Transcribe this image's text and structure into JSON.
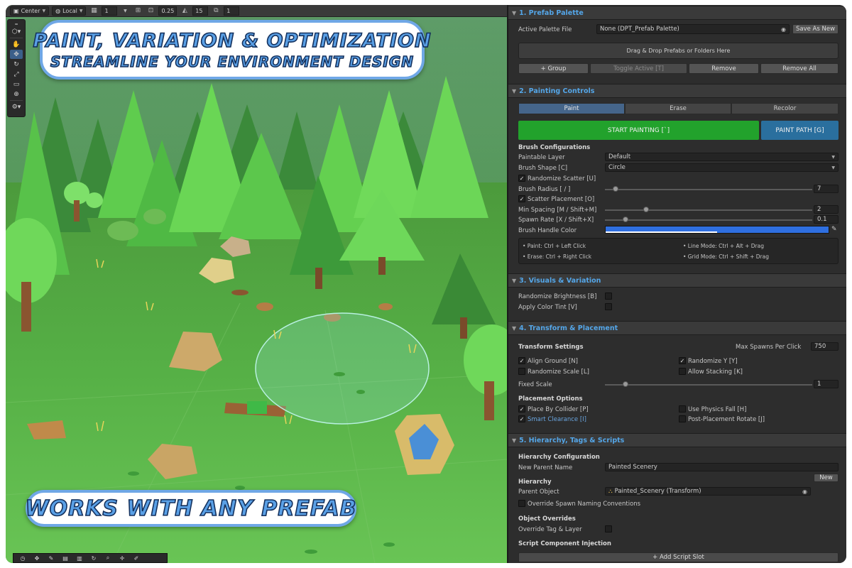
{
  "scene_toolbar": {
    "pivot_label": "Center",
    "space_label": "Local",
    "grid_value": "1",
    "snap_increment": "0.25",
    "rotate_snap": "15",
    "scale_snap": "1"
  },
  "banners": {
    "top_line1": "PAINT, VARIATION & OPTIMIZATION",
    "top_line2": "STREAMLINE YOUR ENVIRONMENT DESIGN",
    "bottom": "WORKS WITH ANY PREFAB"
  },
  "colors": {
    "section_title": "#54a6e8",
    "start_painting": "#22a22c",
    "paint_path": "#2a6f9e",
    "brush_handle": "#2f6fe0",
    "active_tab": "#45658a",
    "smart_clearance_text": "#6aa6e0"
  },
  "prefab_palette": {
    "title": "1. Prefab Palette",
    "active_palette_label": "Active Palette File",
    "active_palette_value": "None (DPT_Prefab Palette)",
    "save_as_new": "Save As New",
    "dropzone": "Drag & Drop Prefabs or Folders Here",
    "buttons": [
      "+ Group",
      "Toggle Active [T]",
      "Remove",
      "Remove All"
    ]
  },
  "painting_controls": {
    "title": "2. Painting Controls",
    "tabs": [
      "Paint",
      "Erase",
      "Recolor"
    ],
    "start_painting": "START PAINTING [`]",
    "paint_path": "PAINT PATH [G]",
    "brush_configurations": "Brush Configurations",
    "paintable_layer_label": "Paintable Layer",
    "paintable_layer_value": "Default",
    "brush_shape_label": "Brush Shape [C]",
    "brush_shape_value": "Circle",
    "randomize_scatter": "Randomize Scatter [U]",
    "brush_radius_label": "Brush Radius [ / ]",
    "brush_radius_value": "7",
    "brush_radius_fraction": 0.05,
    "scatter_placement": "Scatter Placement [O]",
    "min_spacing_label": "Min Spacing [M / Shift+M]",
    "min_spacing_value": "2",
    "min_spacing_fraction": 0.2,
    "spawn_rate_label": "Spawn Rate [X / Shift+X]",
    "spawn_rate_value": "0.1",
    "spawn_rate_fraction": 0.1,
    "brush_handle_color_label": "Brush Handle Color",
    "hints": [
      "• Paint: Ctrl + Left Click",
      "• Line Mode: Ctrl + Alt + Drag",
      "• Erase: Ctrl + Right Click",
      "• Grid Mode: Ctrl + Shift + Drag"
    ]
  },
  "visuals": {
    "title": "3. Visuals & Variation",
    "randomize_brightness": "Randomize Brightness [B]",
    "apply_color_tint": "Apply Color Tint [V]"
  },
  "transform": {
    "title": "4. Transform & Placement",
    "transform_settings": "Transform Settings",
    "max_spawns_label": "Max Spawns Per Click",
    "max_spawns_value": "750",
    "align_ground": "Align Ground [N]",
    "randomize_y": "Randomize Y [Y]",
    "randomize_scale": "Randomize Scale [L]",
    "allow_stacking": "Allow Stacking [K]",
    "fixed_scale_label": "Fixed Scale",
    "fixed_scale_value": "1",
    "fixed_scale_fraction": 0.1,
    "placement_options": "Placement Options",
    "place_by_collider": "Place By Collider [P]",
    "use_physics_fall": "Use Physics Fall [H]",
    "smart_clearance": "Smart Clearance [I]",
    "post_placement_rotate": "Post-Placement Rotate [J]"
  },
  "hierarchy": {
    "title": "5. Hierarchy, Tags & Scripts",
    "hierarchy_configuration": "Hierarchy Configuration",
    "new_parent_name_label": "New Parent Name",
    "new_parent_name_value": "Painted Scenery",
    "new_button": "New",
    "hierarchy_label": "Hierarchy",
    "parent_object_label": "Parent Object",
    "parent_object_value": "Painted_Scenery (Transform)",
    "override_naming": "Override Spawn Naming Conventions",
    "object_overrides": "Object Overrides",
    "override_tag_layer": "Override Tag & Layer",
    "script_injection": "Script Component Injection",
    "add_script_slot": "+ Add Script Slot"
  }
}
